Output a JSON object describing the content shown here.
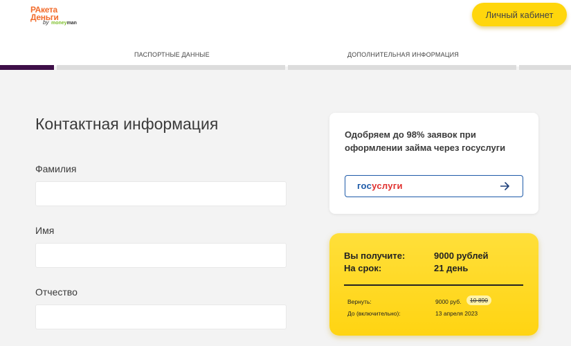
{
  "header": {
    "logo": {
      "line1": "РАкета",
      "line2": "Деньги",
      "by": "by",
      "moneyman_a": "money",
      "moneyman_b": "man"
    },
    "cabinet_button": "Личный кабинет"
  },
  "steps": {
    "tab1": "ПАСПОРТНЫЕ ДАННЫЕ",
    "tab2": "ДОПОЛНИТЕЛЬНАЯ ИНФОРМАЦИЯ",
    "current_step": 1,
    "total_steps": 4
  },
  "form": {
    "title": "Контактная информация",
    "surname_label": "Фамилия",
    "surname_value": "",
    "name_label": "Имя",
    "name_value": "",
    "patronymic_label": "Отчество",
    "patronymic_value": ""
  },
  "gosuslugi_card": {
    "text": "Одобряем до 98% заявок при оформлении займа через госуслуги",
    "logo_a": "гос",
    "logo_b": "услуги",
    "arrow_icon": "arrow-right-icon"
  },
  "summary": {
    "receive_label": "Вы получите:",
    "receive_value": "9000 рублей",
    "term_label": "На срок:",
    "term_value": "21 день",
    "return_label": "Вернуть:",
    "return_value": "9000 руб.",
    "return_old": "10 890",
    "until_label": "До (включительно):",
    "until_value": "13 апреля 2023"
  },
  "colors": {
    "brand_orange": "#f26b2b",
    "accent_yellow": "#ffd60c",
    "progress_active": "#3e0f48",
    "gos_blue": "#1d5aa8",
    "gos_red": "#e0312f"
  }
}
